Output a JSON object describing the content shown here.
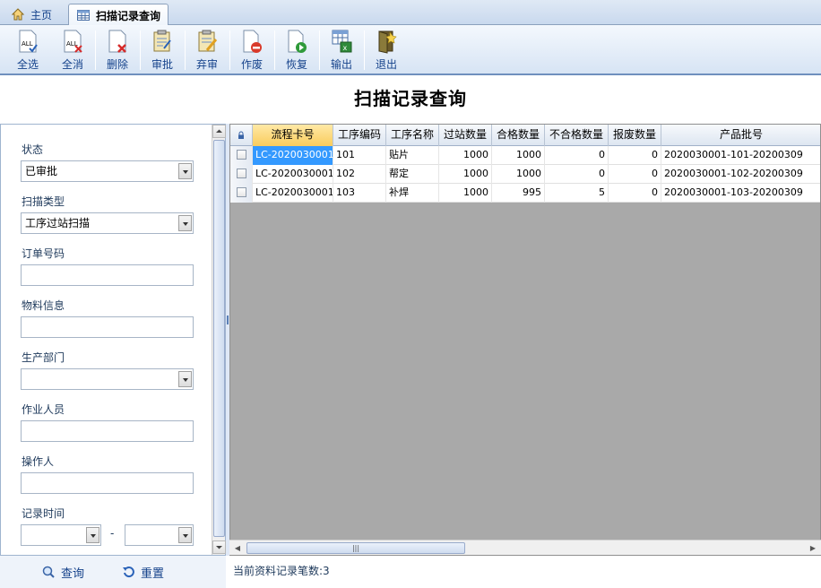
{
  "tabs": [
    {
      "label": "主页",
      "icon": "home-icon"
    },
    {
      "label": "扫描记录查询",
      "icon": "table-icon"
    }
  ],
  "toolbar": {
    "buttons": [
      {
        "label": "全选",
        "icon": "select-all-icon"
      },
      {
        "label": "全消",
        "icon": "deselect-all-icon"
      },
      {
        "label": "删除",
        "icon": "delete-icon"
      },
      {
        "label": "审批",
        "icon": "approve-icon"
      },
      {
        "label": "弃审",
        "icon": "unapprove-icon"
      },
      {
        "label": "作废",
        "icon": "void-icon"
      },
      {
        "label": "恢复",
        "icon": "restore-icon"
      },
      {
        "label": "输出",
        "icon": "export-icon"
      },
      {
        "label": "退出",
        "icon": "exit-icon"
      }
    ]
  },
  "page_title": "扫描记录查询",
  "filters": {
    "status": {
      "label": "状态",
      "value": "已审批"
    },
    "scan_type": {
      "label": "扫描类型",
      "value": "工序过站扫描"
    },
    "order_no": {
      "label": "订单号码",
      "value": ""
    },
    "material": {
      "label": "物料信息",
      "value": ""
    },
    "department": {
      "label": "生产部门",
      "value": ""
    },
    "operator_worker": {
      "label": "作业人员",
      "value": ""
    },
    "operator": {
      "label": "操作人",
      "value": ""
    },
    "record_time": {
      "label": "记录时间",
      "separator": "-"
    }
  },
  "actions": {
    "query": "查询",
    "reset": "重置"
  },
  "grid": {
    "columns": [
      "流程卡号",
      "工序编码",
      "工序名称",
      "过站数量",
      "合格数量",
      "不合格数量",
      "报废数量",
      "产品批号"
    ],
    "rows": [
      [
        "LC-2020030001",
        "101",
        "贴片",
        "1000",
        "1000",
        "0",
        "0",
        "2020030001-101-20200309"
      ],
      [
        "LC-2020030001",
        "102",
        "帮定",
        "1000",
        "1000",
        "0",
        "0",
        "2020030001-102-20200309"
      ],
      [
        "LC-2020030001",
        "103",
        "补焊",
        "1000",
        "995",
        "5",
        "0",
        "2020030001-103-20200309"
      ]
    ]
  },
  "status_text": "当前资料记录笔数:3"
}
